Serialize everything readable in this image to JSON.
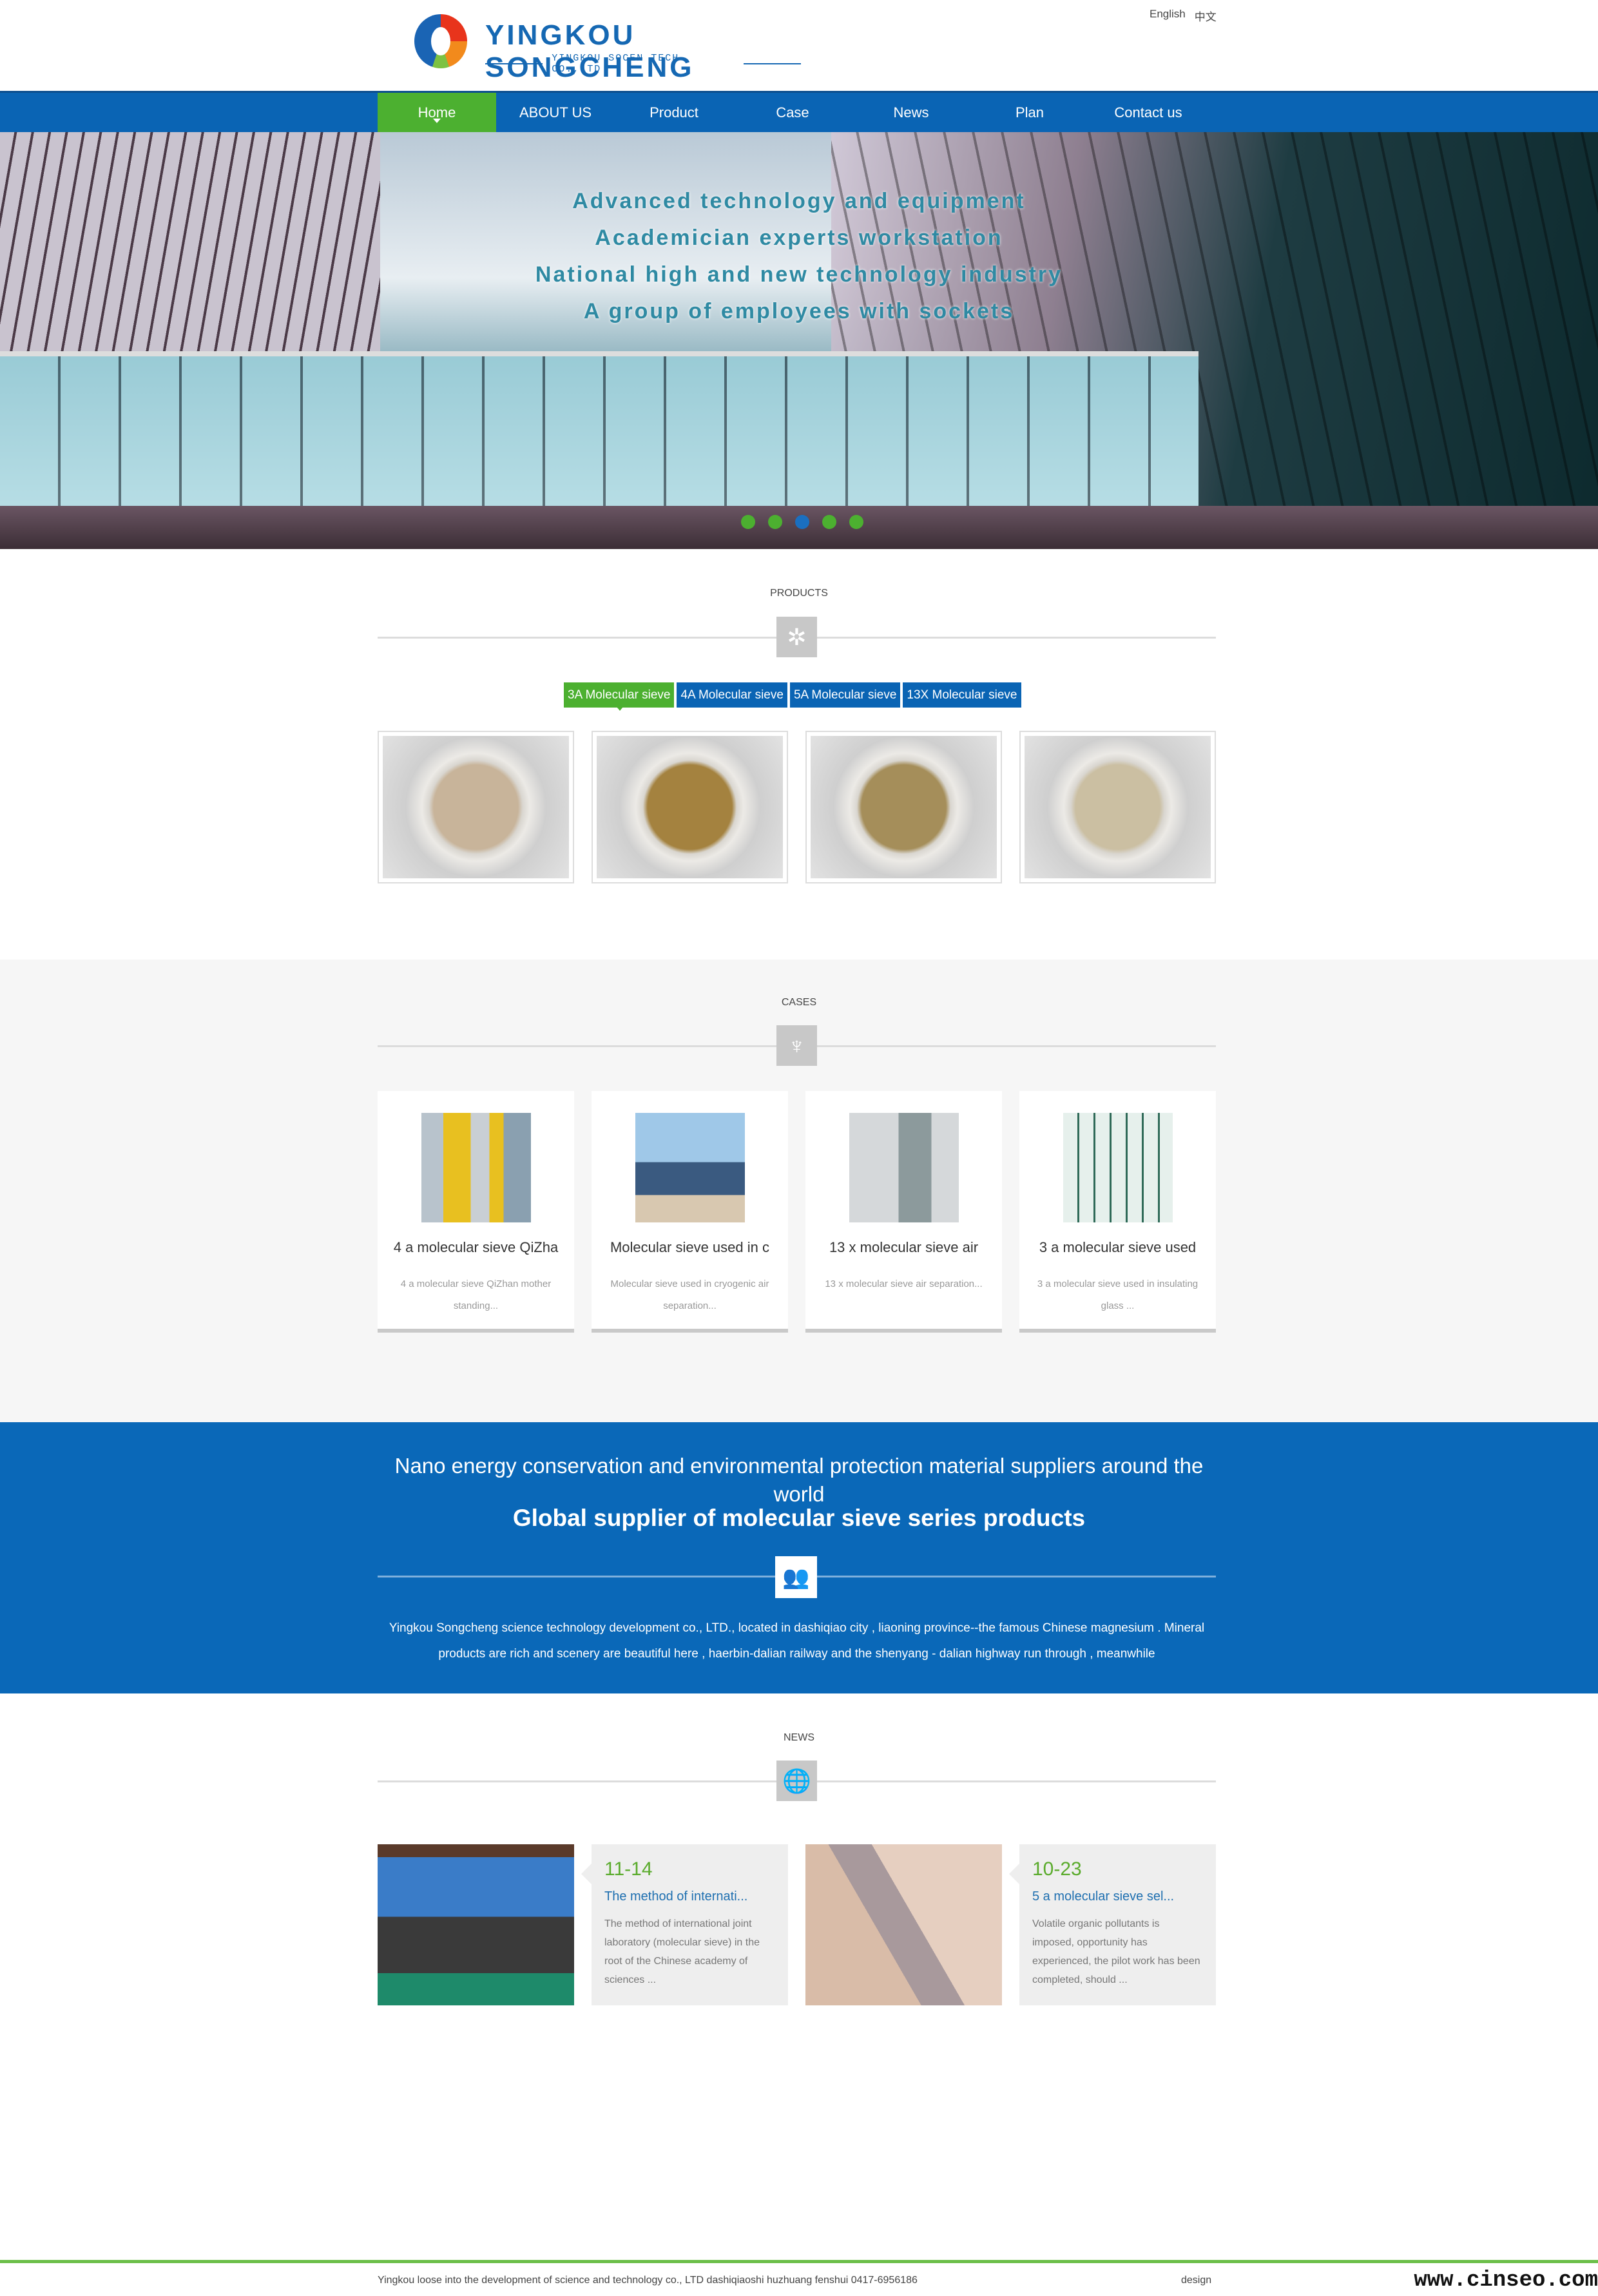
{
  "header": {
    "logo_name": "YINGKOU SONGCHENG",
    "logo_sub": "YINGKOU SOCEN TECH CO.,LTD",
    "lang": [
      "English",
      "中文"
    ]
  },
  "nav": {
    "items": [
      "Home",
      "ABOUT US",
      "Product",
      "Case",
      "News",
      "Plan",
      "Contact us"
    ],
    "active": 0
  },
  "hero": {
    "lines": [
      "Advanced technology and equipment",
      "Academician experts workstation",
      "National high and new technology industry",
      "A group of employees with sockets"
    ],
    "slides": 5,
    "active_slide": 3
  },
  "products": {
    "title": "PRODUCTS",
    "icon": "aperture-icon",
    "tabs": [
      "3A Molecular sieve",
      "4A Molecular sieve",
      "5A Molecular sieve",
      "13X Molecular sieve"
    ],
    "active_tab": 0
  },
  "cases": {
    "title": "CASES",
    "icon": "trophy-icon",
    "items": [
      {
        "title": "4 a molecular sieve QiZha",
        "desc": "4 a molecular sieve QiZhan mother standing..."
      },
      {
        "title": "Molecular sieve used in c",
        "desc": "Molecular sieve used in cryogenic air separation..."
      },
      {
        "title": "13 x molecular sieve air",
        "desc": "13 x molecular sieve air separation..."
      },
      {
        "title": "3 a molecular sieve used",
        "desc": "3 a molecular sieve used in insulating glass ..."
      }
    ]
  },
  "about": {
    "line1": "Nano energy conservation and environmental protection material suppliers around the world",
    "line2": "Global supplier of molecular sieve series products",
    "icon": "users-icon",
    "text": "Yingkou Songcheng science technology development co., LTD., located in dashiqiao city , liaoning province--the famous Chinese magnesium . Mineral products are rich and scenery are beautiful here , haerbin-dalian railway and the shenyang - dalian highway run through , meanwhile"
  },
  "news": {
    "title": "NEWS",
    "icon": "globe-icon",
    "items": [
      {
        "date": "11-14",
        "title": "The method of internati...",
        "desc": "The method of international joint laboratory (molecular sieve) in the root of the Chinese academy of sciences ..."
      },
      {
        "date": "10-23",
        "title": "5 a molecular sieve sel...",
        "desc": "Volatile organic pollutants is imposed, opportunity has experienced, the pilot work has been completed, should ..."
      }
    ]
  },
  "footer": {
    "text": "Yingkou loose into the development of science and technology co., LTD dashiqiaoshi huzhuang fenshui 0417-6956186",
    "design": "design",
    "watermark": "www.cinseo.com"
  },
  "colors": {
    "brand_blue": "#0a64b4",
    "accent_green": "#4cb030"
  }
}
